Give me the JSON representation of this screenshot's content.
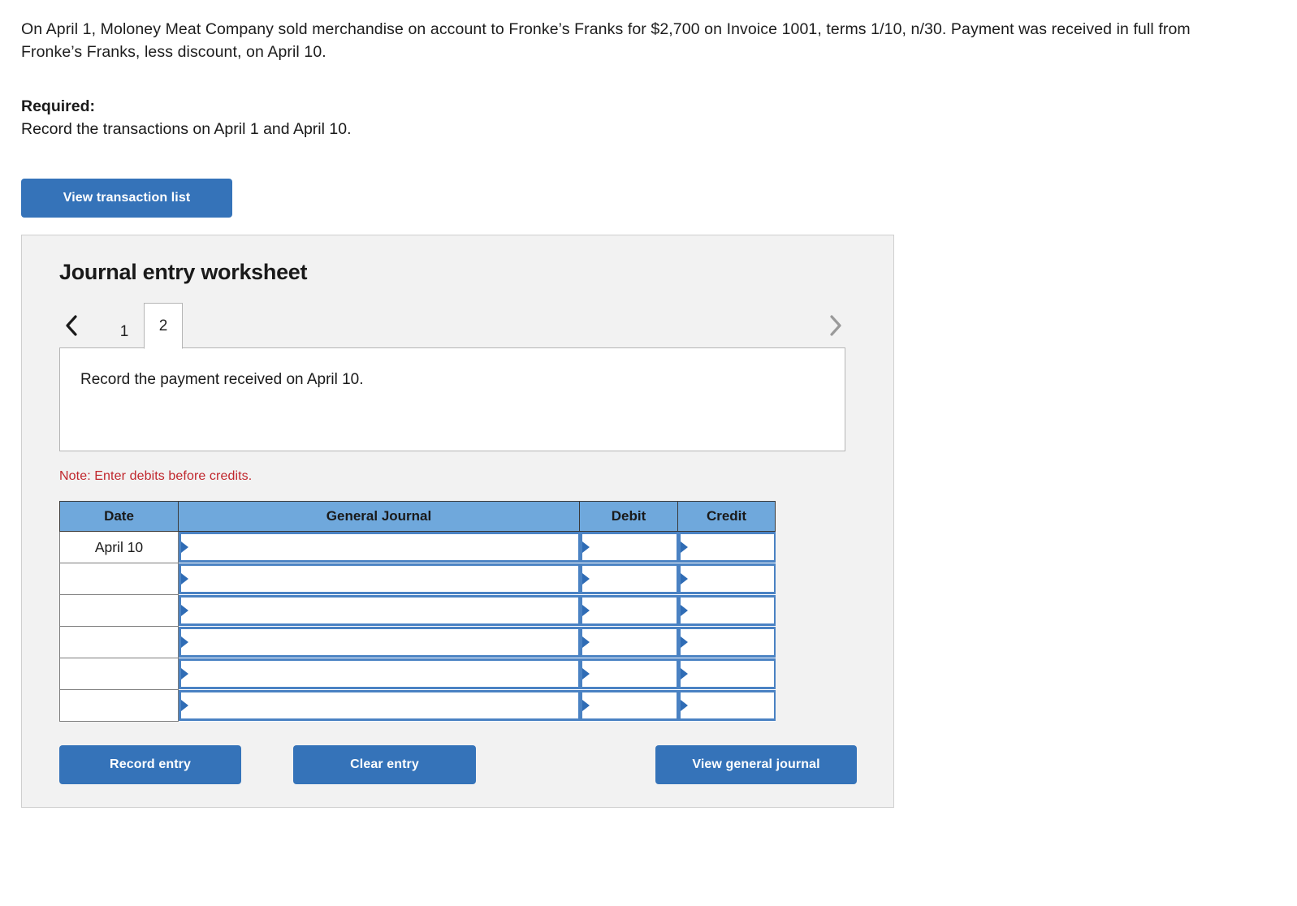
{
  "problem": {
    "statement": "On April 1, Moloney Meat Company sold merchandise on account to Fronke’s Franks for $2,700 on Invoice 1001, terms 1/10, n/30. Payment was received in full from Fronke’s Franks, less discount, on April 10.",
    "required_label": "Required:",
    "required_text": "Record the transactions on April 1 and April 10."
  },
  "toolbar": {
    "view_transaction_list": "View transaction list"
  },
  "worksheet": {
    "title": "Journal entry worksheet",
    "prev_arrow": "chevron-left",
    "next_arrow": "chevron-right",
    "tabs": [
      {
        "label": "1",
        "active": false
      },
      {
        "label": "2",
        "active": true
      }
    ],
    "prompt": "Record the payment received on April 10.",
    "note": "Note: Enter debits before credits.",
    "table": {
      "headers": [
        "Date",
        "General Journal",
        "Debit",
        "Credit"
      ],
      "rows": [
        {
          "date": "April 10",
          "general_journal": "",
          "debit": "",
          "credit": ""
        },
        {
          "date": "",
          "general_journal": "",
          "debit": "",
          "credit": ""
        },
        {
          "date": "",
          "general_journal": "",
          "debit": "",
          "credit": ""
        },
        {
          "date": "",
          "general_journal": "",
          "debit": "",
          "credit": ""
        },
        {
          "date": "",
          "general_journal": "",
          "debit": "",
          "credit": ""
        },
        {
          "date": "",
          "general_journal": "",
          "debit": "",
          "credit": ""
        }
      ]
    },
    "actions": {
      "record_entry": "Record entry",
      "clear_entry": "Clear entry",
      "view_general_journal": "View general journal"
    }
  },
  "colors": {
    "button_blue": "#3573b9",
    "table_header_blue": "#6fa8dc",
    "dropdown_border_blue": "#4a82c3",
    "note_red": "#c0272d",
    "panel_gray": "#f2f2f2",
    "panel_border": "#cfcfcf"
  }
}
